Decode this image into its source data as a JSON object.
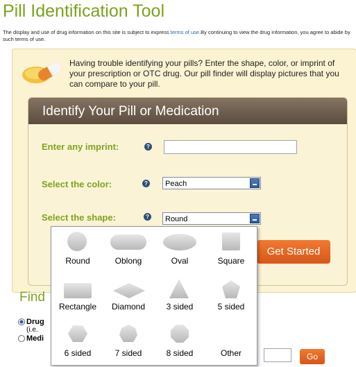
{
  "page": {
    "title": "Pill Identification Tool",
    "disclaimer_pre": "The display and use of drug information on this site is subject to express ",
    "disclaimer_link": "terms of use",
    "disclaimer_post": ".By continuing to view the drug information, you agree to abide by such terms of use.",
    "intro": "Having trouble identifying your pills? Enter the shape, color, or imprint of your prescription or OTC drug. Our pill finder will display pictures that you can compare to your pill."
  },
  "form": {
    "title": "Identify Your Pill or Medication",
    "imprint_label": "Enter any imprint:",
    "imprint_value": "",
    "color_label": "Select the color:",
    "color_value": "Peach",
    "shape_label": "Select the shape:",
    "shape_value": "Round",
    "help_glyph": "?",
    "submit_label": "Get Started"
  },
  "shapes": [
    "Round",
    "Oblong",
    "Oval",
    "Square",
    "Rectangle",
    "Diamond",
    "3 sided",
    "5 sided",
    "6 sided",
    "7 sided",
    "8 sided",
    "Other"
  ],
  "find": {
    "heading": "Find",
    "radio1": "Drug",
    "radio1_sub": "(i.e.",
    "radio2": "Medi",
    "go_label": "Go"
  },
  "colors": {
    "accent_green": "#7aa31a",
    "header_brown": "#6f5f50",
    "button_orange": "#e4641f",
    "panel_bg": "#fbf3d2"
  }
}
